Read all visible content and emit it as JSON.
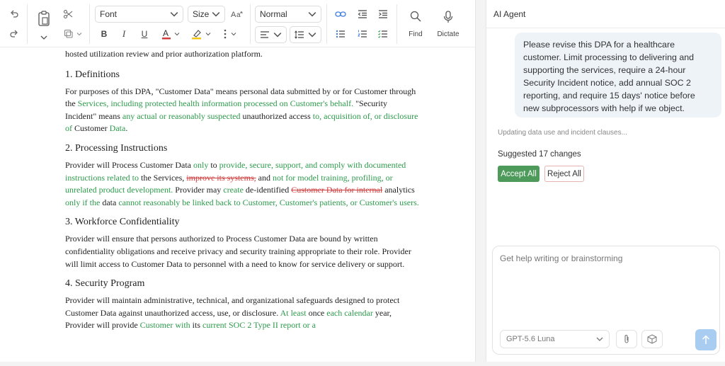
{
  "toolbar": {
    "font_label": "Font",
    "size_label": "Size",
    "style_label": "Normal",
    "find_label": "Find",
    "dictate_label": "Dictate"
  },
  "document": {
    "intro_tail": "hosted utilization review and prior authorization platform.",
    "s1_heading": "1. Definitions",
    "s1_a": "For purposes of this DPA, \"Customer Data\" means personal data submitted by or for Customer through the ",
    "s1_b": "Services, including protected health information processed on Customer's behalf.",
    "s1_c": " \"Security Incident\" means ",
    "s1_d": "any actual or reasonably suspected",
    "s1_e": " unauthorized access ",
    "s1_f": "to, acquisition of, or disclosure of",
    "s1_g": " Customer ",
    "s1_h": "Data",
    "s1_i": ".",
    "s2_heading": "2. Processing Instructions",
    "s2_a": "Provider will Process Customer Data ",
    "s2_b": "only",
    "s2_c": " to ",
    "s2_d": "provide, secure, support, and comply with documented instructions related to",
    "s2_e": " the Services, ",
    "s2_f": "improve its systems,",
    "s2_g": " and ",
    "s2_h": "not for model training, profiling, or unrelated product development.",
    "s2_i": " Provider may ",
    "s2_j": "create",
    "s2_k": " de-identified ",
    "s2_l": "Customer Data for internal",
    "s2_m": " analytics ",
    "s2_n": "only if the",
    "s2_o": " data ",
    "s2_p": "cannot reasonably be linked back to Customer, Customer's patients, or Customer's users.",
    "s3_heading": "3. Workforce Confidentiality",
    "s3_text": "Provider will ensure that persons authorized to Process Customer Data are bound by written confidentiality obligations and receive privacy and security training appropriate to their role. Provider will limit access to Customer Data to personnel with a need to know for service delivery or support.",
    "s4_heading": "4. Security Program",
    "s4_a": "Provider will maintain administrative, technical, and organizational safeguards designed to protect Customer Data against unauthorized access, use, or disclosure. ",
    "s4_b": "At least",
    "s4_c": " once ",
    "s4_d": "each calendar",
    "s4_e": " year, Provider will provide ",
    "s4_f": "Customer with",
    "s4_g": " its ",
    "s4_h": "current SOC 2 Type II report or a"
  },
  "agent": {
    "title": "AI Agent",
    "user_message": "Please revise this DPA for a healthcare customer. Limit processing to delivering and supporting the services, require a 24-hour Security Incident notice, add annual SOC 2 reporting, and require 15 days' notice before new subprocessors with help if we object.",
    "status": "Updating data use and incident clauses...",
    "suggested": "Suggested 17 changes",
    "accept_label": "Accept All",
    "reject_label": "Reject All",
    "input_placeholder": "Get help writing or brainstorming",
    "model_label": "GPT-5.6 Luna"
  },
  "colors": {
    "insert": "#2c9a4b",
    "delete": "#d23c3c",
    "accept_bg": "#4e9a5a",
    "send_bg": "#a9cdf0"
  }
}
